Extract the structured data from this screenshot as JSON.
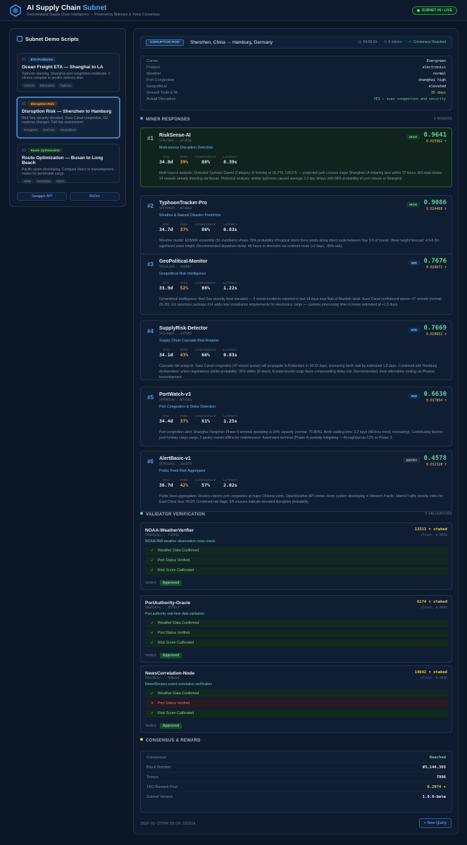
{
  "header": {
    "title_main": "AI Supply Chain",
    "title_accent": "Subnet",
    "subtitle": "Decentralized Supply Chain Intelligence — Powered by Bittensor & Yuma Consensus",
    "live_badge": "SUBNET #6 • LIVE"
  },
  "sidebar": {
    "title": "Subnet Demo Scripts",
    "scripts": [
      {
        "num": "01",
        "badge": "ETA Prediction",
        "title": "Ocean Freight ETA — Shanghai to LA",
        "desc": "Typhoon warning, Shanghai port congestion moderate. 6 miners compete to predict delivery time.",
        "tags": [
          "CDDCE",
          "Electronics",
          "Typhoon"
        ]
      },
      {
        "num": "02",
        "badge": "Disruption Risk",
        "title": "Disruption Risk — Shenzhen to Hamburg",
        "desc": "Red Sea security elevated, Suez Canal congestion, EU customs changes. Full risk assessment.",
        "tags": [
          "Evergreen",
          "Red Sea",
          "Geopolitical"
        ]
      },
      {
        "num": "03",
        "badge": "Route Optimization",
        "title": "Route Optimization — Busan to Long Beach",
        "desc": "Pacific storm developing. Compare direct vs transshipment routes for perishable cargo.",
        "tags": [
          "HMM",
          "Perishable",
          "Storm"
        ]
      }
    ],
    "swagger_label": "Swagger API",
    "redoc_label": "ReDoc"
  },
  "query": {
    "type_badge": "DISRUPTION RISK",
    "route": "Shenzhen, China → Hamburg, Germany",
    "time": "04:59:29",
    "miners": "6 miners",
    "consensus": "Consensus Reached"
  },
  "info": [
    {
      "k": "Carrier",
      "v": "Evergreen",
      "tone": ""
    },
    {
      "k": "Product",
      "v": "electronics",
      "tone": ""
    },
    {
      "k": "Weather",
      "v": "normal",
      "tone": ""
    },
    {
      "k": "Port Congestion",
      "v": "shanghai high",
      "tone": ""
    },
    {
      "k": "Geopolitical",
      "v": "elevated",
      "tone": ""
    },
    {
      "k": "Ground Truth ETA",
      "v": "35 days",
      "tone": "yel"
    },
    {
      "k": "Actual Disruption",
      "v": "YES — suez congestion and security",
      "tone": "grn"
    }
  ],
  "miner_section": {
    "title": "MINER RESPONSES",
    "count": "6 MINERS"
  },
  "stat_labels": {
    "eta": "ETA",
    "risk": "RISK",
    "confidence": "CONFIDENCE",
    "latency": "LATENCY"
  },
  "miners": [
    {
      "rank": "#1",
      "name": "RiskSense-AI",
      "hotkey": "5FRx7K9r...eTa91b",
      "spec": "Multi-source Disruption Detection",
      "tier": "HIGH",
      "score": "0.9641",
      "reward": "0.025962 τ",
      "eta": "34.8d",
      "risk": "39%",
      "conf": "88%",
      "lat": "8.39s",
      "desc": "Multi-source analysis: Detected Typhoon Gaemi (Category 3) forming at 18.2°N, 128.5°E — projected path crosses major Shanghai-LA shipping lane within 72 hours. AIS data shows 14 vessels already diverting via Busan. Historical analysis: similar typhoons caused average 3.2 day delays with 68% probability of port closure at Shanghai."
    },
    {
      "rank": "#2",
      "name": "TyphoonTracker-Pro",
      "hotkey": "5FTYPhkP...07n8b4",
      "spec": "Weather & Natural Disaster Prediction",
      "tier": "HIGH",
      "score": "0.9086",
      "reward": "0.024468 τ",
      "eta": "34.7d",
      "risk": "37%",
      "conf": "86%",
      "lat": "0.83s",
      "desc": "Weather model: ECMWF ensemble (51 members) shows 78% probability of tropical storm force winds along direct route between Day 3-5 of transit. Wave height forecast: 4.5-6.2m significant wave height. Recommended departure delay: 48 hours or diversion via northern route (+2 days, -35% risk)."
    },
    {
      "rank": "#3",
      "name": "GeoPolitical-Monitor",
      "hotkey": "5FGeL2m9...dk89bf",
      "spec": "Geopolitical Risk Intelligence",
      "tier": "MID",
      "score": "0.7676",
      "reward": "0.020671 τ",
      "eta": "33.9d",
      "risk": "52%",
      "conf": "86%",
      "lat": "1.22s",
      "desc": "Geopolitical Intelligence: Red Sea security level elevated — 3 vessel incidents reported in last 14 days near Bab el-Mandeb strait. Suez Canal northbound queue: 47 vessels (normal: 25-30). EU sanctions package #14 adds new compliance requirements for electronics cargo — customs processing time increase estimated at +1.5 days."
    },
    {
      "rank": "#4",
      "name": "SupplyRisk-Detector",
      "hotkey": "5FSrHq0f...13f985",
      "spec": "Supply Chain Cascade Risk Analysis",
      "tier": "MID",
      "score": "0.7669",
      "reward": "0.020652 τ",
      "eta": "34.1d",
      "risk": "43%",
      "conf": "66%",
      "lat": "0.83s",
      "desc": "Cascade risk analysis: Suez Canal congestion (47-vessel queue) will propagate to Rotterdam in 18-22 days, increasing berth wait by estimated 1.8 days. Combined with Hamburg dockworkers' union negotiations (strike probability: 35% within 30 days), Europe-bound cargo faces compounding delay risk. Recommended: book alternative routing via Piraeus transshipment."
    },
    {
      "rank": "#5",
      "name": "PortWatch-v3",
      "hotkey": "5FPWV2e8...07e56a",
      "spec": "Port Congestion & Strike Detection",
      "tier": "MID",
      "score": "0.6630",
      "reward": "0.017854 τ",
      "eta": "34.4d",
      "risk": "37%",
      "conf": "61%",
      "lat": "1.25s",
      "desc": "Port congestion alert: Shanghai Yangshan Phase 4 terminal operating at 94% capacity (normal: 75-80%). Berth waiting time: 3.2 days (48-hour trend: increasing). Contributing factors: post-holiday cargo surge, 2 gantry cranes offline for maintenance. Automated terminal (Phase 4) partially mitigating — throughput up 12% vs Phase 3."
    },
    {
      "rank": "#6",
      "name": "AlertBasic-v1",
      "hotkey": "5FAb1aSm...1b187d",
      "spec": "Public Feed Risk Aggregator",
      "tier": "ENTRY",
      "score": "0.4578",
      "reward": "0.012328 τ",
      "eta": "36.7d",
      "risk": "42%",
      "conf": "57%",
      "lat": "2.02s",
      "desc": "Public feed aggregation: Reuters reports port congestion at major Chinese ports. OpenWeather API shows storm system developing in Western Pacific. MarineTraffic density index for East China Sea: HIGH. Combined risk flags: 3/5 sources indicate elevated disruption probability."
    }
  ],
  "validator_section": {
    "title": "VALIDATOR VERIFICATION",
    "count": "3 VALIDATORS"
  },
  "verdict_label": "Verdict:",
  "validators": [
    {
      "name": "NOAA-WeatherVerifier",
      "hotkey": "5VnN1oAp... f37b1c",
      "desc": "NOAA/JMA weather observation cross-check",
      "stake": "13313 τ staked",
      "vtrust": "vTrust: 0.8928",
      "checks": [
        {
          "label": "Weather Data Confirmed",
          "ok": true
        },
        {
          "label": "Port Status Verified",
          "ok": true
        },
        {
          "label": "Risk Score Calibrated",
          "ok": true
        }
      ],
      "verdict": "Approved"
    },
    {
      "name": "PortAuthority-Oracle",
      "hotkey": "5VpA2kYq... 05f6cf",
      "desc": "Port authority real-time data validation",
      "stake": "6174 τ staked",
      "vtrust": "vTrust: 0.9844",
      "checks": [
        {
          "label": "Weather Data Confirmed",
          "ok": true
        },
        {
          "label": "Port Status Verified",
          "ok": true
        },
        {
          "label": "Risk Score Calibrated",
          "ok": true
        }
      ],
      "verdict": "Approved"
    },
    {
      "name": "NewsCorrelation-Node",
      "hotkey": "5VnC8L1r... 4d6ea4",
      "desc": "News/Reuters event correlation verification",
      "stake": "14642 τ staked",
      "vtrust": "vTrust: 0.9835",
      "checks": [
        {
          "label": "Weather Data Confirmed",
          "ok": true
        },
        {
          "label": "Port Status Verified",
          "ok": false
        },
        {
          "label": "Risk Score Calibrated",
          "ok": true
        }
      ],
      "verdict": "Approved"
    }
  ],
  "consensus_section": {
    "title": "CONSENSUS & REWARD"
  },
  "consensus": [
    {
      "k": "Consensus",
      "v": "Reached",
      "tone": "grn"
    },
    {
      "k": "Block Number",
      "v": "#3,144,393",
      "tone": ""
    },
    {
      "k": "Tempo",
      "v": "7996",
      "tone": ""
    },
    {
      "k": "TAO Reward Pool",
      "v": "0.2974 τ",
      "tone": "yel"
    },
    {
      "k": "Subnet Version",
      "v": "1.0.0-beta",
      "tone": ""
    }
  ],
  "footer": {
    "timestamp": "2026-02-25T04:59:29.532524",
    "new_query": "+ New Query"
  }
}
